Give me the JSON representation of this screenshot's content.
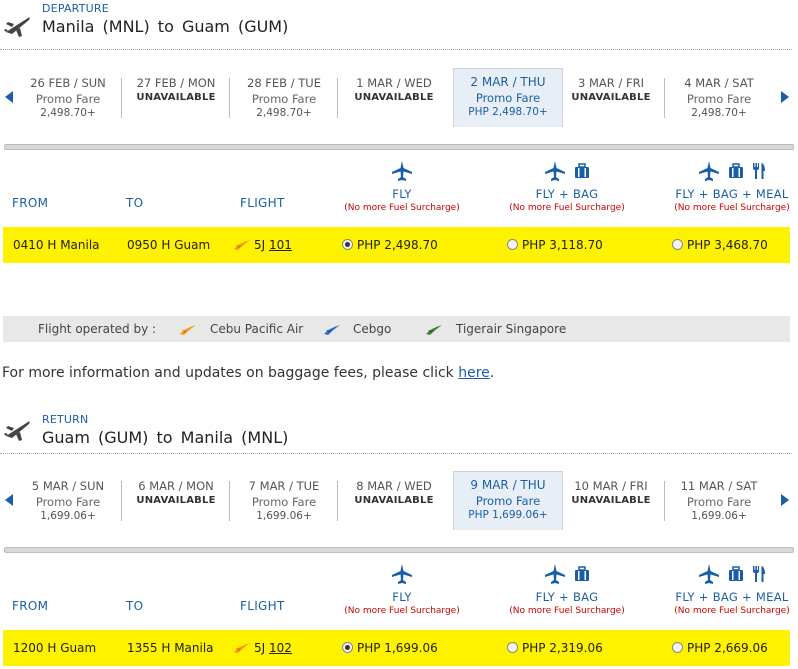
{
  "departure": {
    "label": "DEPARTURE",
    "route": "Manila  (MNL)  to  Guam  (GUM)",
    "dates": [
      {
        "date": "26 FEB / SUN",
        "status": "Promo Fare",
        "price": "2,498.70+"
      },
      {
        "date": "27 FEB / MON",
        "status": "UNAVAILABLE",
        "price": ""
      },
      {
        "date": "28 FEB / TUE",
        "status": "Promo Fare",
        "price": "2,498.70+"
      },
      {
        "date": "1 MAR / WED",
        "status": "UNAVAILABLE",
        "price": ""
      },
      {
        "date": "2 MAR / THU",
        "status": "Promo Fare",
        "price": "PHP 2,498.70+",
        "selected": true
      },
      {
        "date": "3 MAR / FRI",
        "status": "UNAVAILABLE",
        "price": ""
      },
      {
        "date": "4 MAR / SAT",
        "status": "Promo Fare",
        "price": "2,498.70+"
      }
    ],
    "columns": {
      "from": "FROM",
      "to": "TO",
      "flight": "FLIGHT"
    },
    "fares": [
      {
        "name": "FLY",
        "note": "(No more Fuel Surcharge)"
      },
      {
        "name": "FLY + BAG",
        "note": "(No more Fuel Surcharge)"
      },
      {
        "name": "FLY + BAG + MEAL",
        "note": "(No more Fuel Surcharge)"
      }
    ],
    "flight": {
      "from": "0410 H  Manila",
      "to": "0950 H  Guam",
      "carrier": "5J",
      "number": "101",
      "prices": [
        "PHP 2,498.70",
        "PHP 3,118.70",
        "PHP 3,468.70"
      ],
      "selected_index": 0
    }
  },
  "operated_by": {
    "label": "Flight operated by :",
    "airlines": [
      {
        "name": "Cebu Pacific Air",
        "color": "#f39a1e"
      },
      {
        "name": "Cebgo",
        "color": "#2f6fc9"
      },
      {
        "name": "Tigerair Singapore",
        "color": "#3a8a2a"
      }
    ]
  },
  "baggage_info": {
    "text": "For more information and updates on baggage fees, please click ",
    "link": "here",
    "suffix": "."
  },
  "return": {
    "label": "RETURN",
    "route": "Guam  (GUM) to  Manila  (MNL)",
    "dates": [
      {
        "date": "5 MAR / SUN",
        "status": "Promo Fare",
        "price": "1,699.06+"
      },
      {
        "date": "6 MAR / MON",
        "status": "UNAVAILABLE",
        "price": ""
      },
      {
        "date": "7 MAR / TUE",
        "status": "Promo Fare",
        "price": "1,699.06+"
      },
      {
        "date": "8 MAR / WED",
        "status": "UNAVAILABLE",
        "price": ""
      },
      {
        "date": "9 MAR / THU",
        "status": "Promo Fare",
        "price": "PHP 1,699.06+",
        "selected": true
      },
      {
        "date": "10 MAR / FRI",
        "status": "UNAVAILABLE",
        "price": ""
      },
      {
        "date": "11 MAR / SAT",
        "status": "Promo Fare",
        "price": "1,699.06+"
      }
    ],
    "columns": {
      "from": "FROM",
      "to": "TO",
      "flight": "FLIGHT"
    },
    "fares": [
      {
        "name": "FLY",
        "note": "(No more Fuel Surcharge)"
      },
      {
        "name": "FLY + BAG",
        "note": "(No more Fuel Surcharge)"
      },
      {
        "name": "FLY + BAG + MEAL",
        "note": "(No more Fuel Surcharge)"
      }
    ],
    "flight": {
      "from": "1200 H  Guam",
      "to": "1355 H  Manila",
      "carrier": "5J",
      "number": "102",
      "prices": [
        "PHP 1,699.06",
        "PHP 2,319.06",
        "PHP 2,669.06"
      ],
      "selected_index": 0
    }
  },
  "colors": {
    "accent": "#1a5ea8",
    "highlight": "#fff200",
    "surcharge": "#cc0000"
  }
}
